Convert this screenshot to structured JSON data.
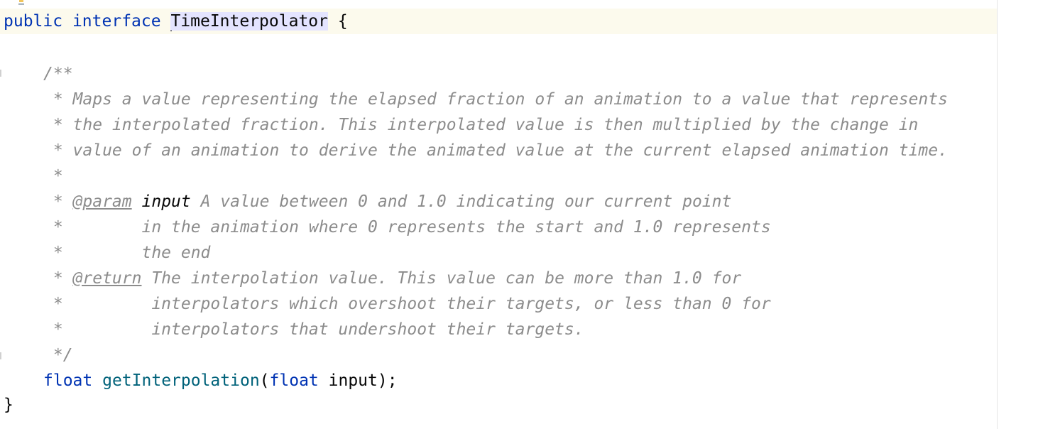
{
  "editor": {
    "colors": {
      "keyword": "#0033b3",
      "method": "#00627a",
      "comment": "#8c8c8c",
      "current_line": "#fcfaed",
      "identifier_highlight": "#e4e4ff"
    },
    "line_interface": {
      "kw_public": "public",
      "kw_interface": "interface",
      "name": "TimeInterpolator",
      "brace": "{"
    },
    "doc": {
      "open": "/**",
      "l1": " * Maps a value representing the elapsed fraction of an animation to a value that represents",
      "l2": " * the interpolated fraction. This interpolated value is then multiplied by the change in",
      "l3": " * value of an animation to derive the animated value at the current elapsed animation time.",
      "l4": " *",
      "param_star": " * ",
      "param_tag": "@param",
      "param_name": "input",
      "param_desc": " A value between 0 and 1.0 indicating our current point",
      "param_cont1": " *        in the animation where 0 represents the start and 1.0 represents",
      "param_cont2": " *        the end",
      "return_star": " * ",
      "return_tag": "@return",
      "return_desc": " The interpolation value. This value can be more than 1.0 for",
      "return_cont1": " *         interpolators which overshoot their targets, or less than 0 for",
      "return_cont2": " *         interpolators that undershoot their targets.",
      "close": " */"
    },
    "method_line": {
      "kw_float": "float",
      "name": "getInterpolation",
      "open_paren": "(",
      "param_type": "float",
      "param_rest": " input);"
    },
    "closing_brace": "}",
    "gutter_icons": [
      "intention-bulb-icon"
    ]
  }
}
